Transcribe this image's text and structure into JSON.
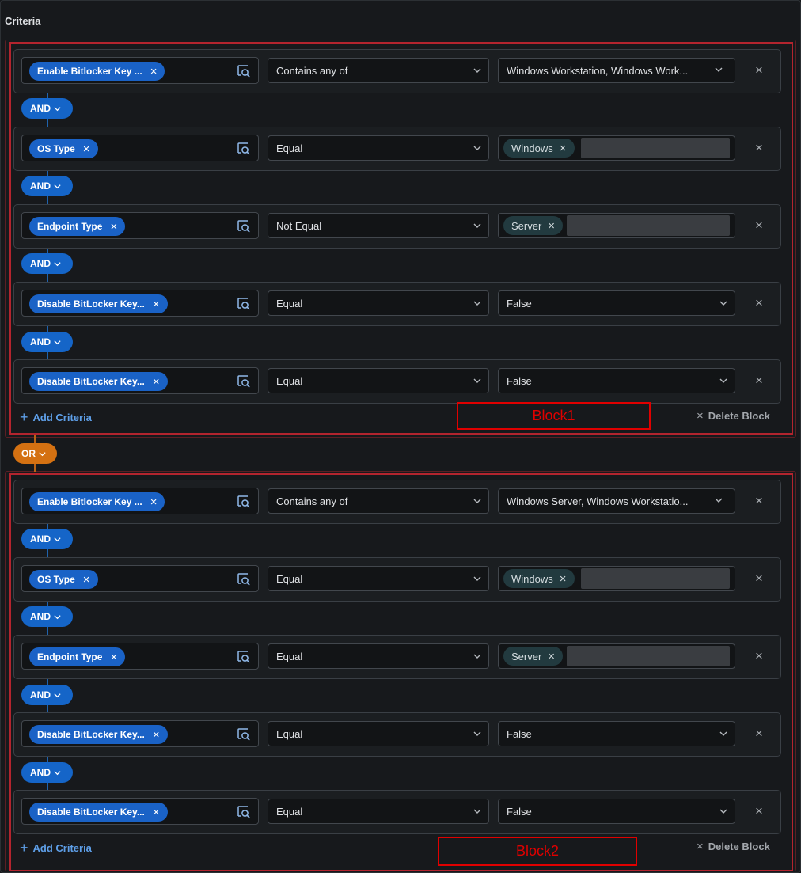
{
  "criteria_title": "Criteria",
  "or_label": "OR",
  "and_label": "AND",
  "add_criteria_label": "Add Criteria",
  "delete_block_label": "Delete Block",
  "remove_icon_glyph": "×",
  "blocks": [
    {
      "annotation": "Block1",
      "rows": [
        {
          "field": "Enable Bitlocker Key ...",
          "operator": "Contains any of",
          "value": "Windows Workstation, Windows Work...",
          "value_kind": "select"
        },
        {
          "field": "OS Type",
          "operator": "Equal",
          "value": "Windows",
          "value_kind": "tag"
        },
        {
          "field": "Endpoint Type",
          "operator": "Not Equal",
          "value": "Server",
          "value_kind": "tag"
        },
        {
          "field": "Disable BitLocker Key...",
          "operator": "Equal",
          "value": "False",
          "value_kind": "select"
        },
        {
          "field": "Disable BitLocker Key...",
          "operator": "Equal",
          "value": "False",
          "value_kind": "select"
        }
      ]
    },
    {
      "annotation": "Block2",
      "rows": [
        {
          "field": "Enable Bitlocker Key ...",
          "operator": "Contains any of",
          "value": "Windows Server, Windows Workstatio...",
          "value_kind": "select"
        },
        {
          "field": "OS Type",
          "operator": "Equal",
          "value": "Windows",
          "value_kind": "tag"
        },
        {
          "field": "Endpoint Type",
          "operator": "Equal",
          "value": "Server",
          "value_kind": "tag"
        },
        {
          "field": "Disable BitLocker Key...",
          "operator": "Equal",
          "value": "False",
          "value_kind": "select"
        },
        {
          "field": "Disable BitLocker Key...",
          "operator": "Equal",
          "value": "False",
          "value_kind": "select"
        }
      ]
    }
  ],
  "colors": {
    "background": "#17191c",
    "chip": "#1a62c6",
    "and_button": "#1565c8",
    "or_button": "#d47112",
    "link": "#5e9fe8",
    "annotation_red": "#e00000",
    "block_border": "#b3242e"
  },
  "icons": {
    "lookup": "search-lookup-icon",
    "chevron": "chevron-down-icon",
    "remove": "close-icon",
    "add": "plus-icon"
  }
}
